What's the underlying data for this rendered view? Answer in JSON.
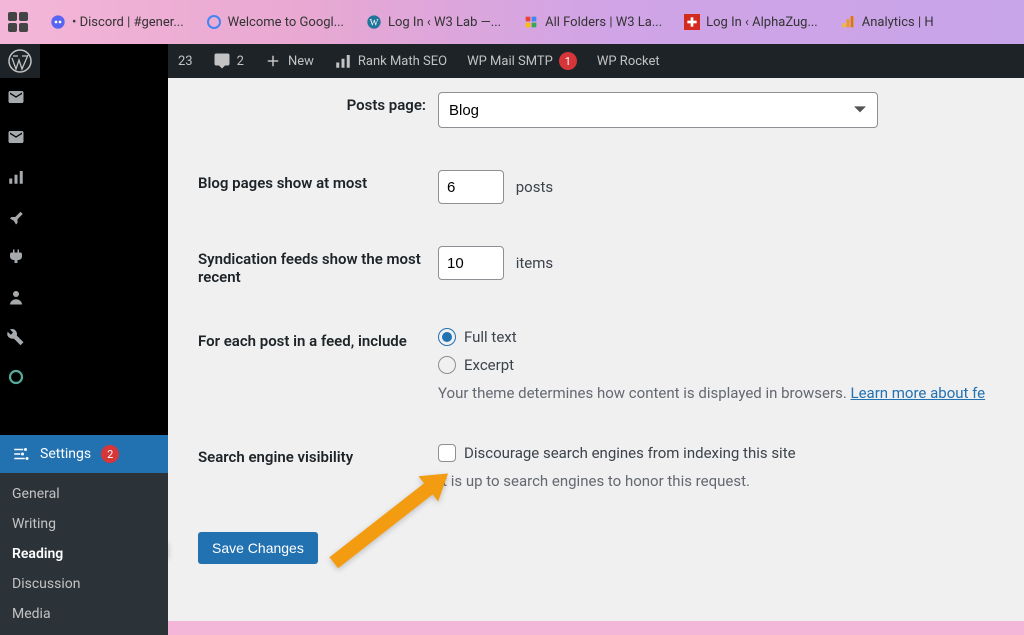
{
  "browser_tabs": [
    {
      "label": "• Discord | #gener..."
    },
    {
      "label": "Welcome to Googl..."
    },
    {
      "label": "Log In ‹ W3 Lab —..."
    },
    {
      "label": "All Folders | W3 La..."
    },
    {
      "label": "Log In ‹ AlphaZug..."
    },
    {
      "label": "Analytics | H"
    }
  ],
  "adminbar": {
    "comments_count": "23",
    "speech_count": "2",
    "new_label": "New",
    "rankmath": "Rank Math SEO",
    "mailsmtp": "WP Mail SMTP",
    "mailsmtp_badge": "1",
    "wprocket": "WP Rocket"
  },
  "sidebar": {
    "settings_label": "Settings",
    "settings_badge": "2",
    "items": [
      {
        "label": "General"
      },
      {
        "label": "Writing"
      },
      {
        "label": "Reading"
      },
      {
        "label": "Discussion"
      },
      {
        "label": "Media"
      }
    ]
  },
  "form": {
    "posts_page_label": "Posts page:",
    "posts_page_value": "Blog",
    "blog_pages_label": "Blog pages show at most",
    "blog_pages_value": "6",
    "blog_pages_unit": "posts",
    "synd_label": "Syndication feeds show the most recent",
    "synd_value": "10",
    "synd_unit": "items",
    "feed_label": "For each post in a feed, include",
    "feed_full": "Full text",
    "feed_excerpt": "Excerpt",
    "feed_help_pre": "Your theme determines how content is displayed in browsers. ",
    "feed_help_link": "Learn more about fe",
    "sev_label": "Search engine visibility",
    "sev_check": "Discourage search engines from indexing this site",
    "sev_help": "It is up to search engines to honor this request.",
    "save": "Save Changes"
  }
}
